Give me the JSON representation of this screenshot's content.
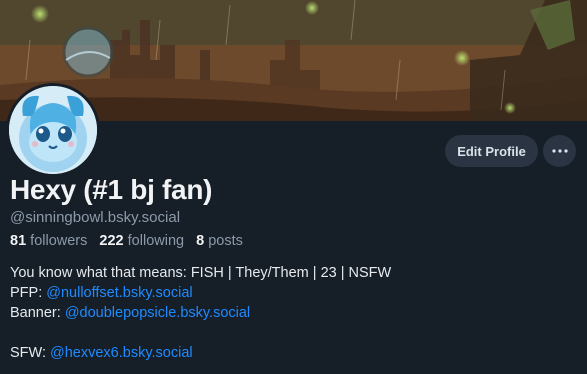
{
  "header": {
    "edit_label": "Edit Profile",
    "more_label": "···"
  },
  "profile": {
    "display_name": "Hexy (#1 bj fan)",
    "handle": "@sinningbowl.bsky.social"
  },
  "stats": {
    "followers_count": "81",
    "followers_label": "followers",
    "following_count": "222",
    "following_label": "following",
    "posts_count": "8",
    "posts_label": "posts"
  },
  "bio": {
    "line1": "You know what that means: FISH | They/Them | 23 | NSFW",
    "pfp_label": "PFP: ",
    "pfp_link": "@nulloffset.bsky.social",
    "banner_label": "Banner: ",
    "banner_link": "@doublepopsicle.bsky.social",
    "sfw_label": "SFW: ",
    "sfw_link": "@hexvex6.bsky.social"
  },
  "colors": {
    "background": "#161e27",
    "link": "#1f8bff",
    "muted_text": "#8c9aab",
    "button_bg": "#2a3442"
  },
  "icons": {
    "more": "ellipsis-icon"
  }
}
